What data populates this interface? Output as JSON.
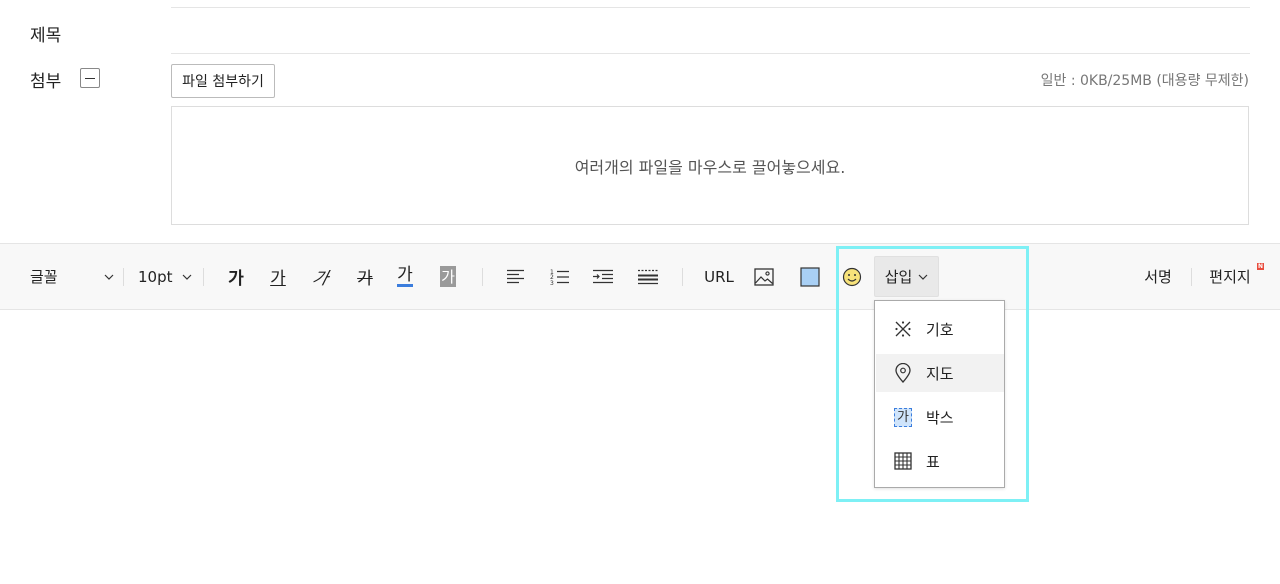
{
  "form": {
    "subject_label": "제목",
    "attachment_label": "첨부",
    "attach_button": "파일 첨부하기",
    "capacity_text": "일반 : 0KB/25MB (대용량 무제한)",
    "dropzone_text": "여러개의 파일을 마우스로 끌어놓으세요."
  },
  "toolbar": {
    "font_select": "글꼴",
    "size_select": "10pt",
    "bold": "가",
    "underline": "가",
    "italic": "가",
    "strikethrough": "가",
    "font_color": "가",
    "bg_color": "가",
    "url": "URL",
    "insert": "삽입",
    "signature": "서명",
    "stationery": "편지지",
    "new_badge": "N",
    "colors": {
      "font_color_underline": "#3b7ddd",
      "bg_color_fill": "#9a9a9a",
      "box_fill": "#a9d0f5",
      "emoji_fill": "#f7e27a",
      "highlight_border": "#7ef0f5",
      "new_badge": "#e84c3d"
    }
  },
  "insert_menu": {
    "items": [
      {
        "label": "기호",
        "icon": "reference-mark-icon"
      },
      {
        "label": "지도",
        "icon": "map-pin-icon"
      },
      {
        "label": "박스",
        "icon": "text-box-icon",
        "icon_text": "가"
      },
      {
        "label": "표",
        "icon": "table-grid-icon"
      }
    ],
    "hovered_item": "지도"
  }
}
